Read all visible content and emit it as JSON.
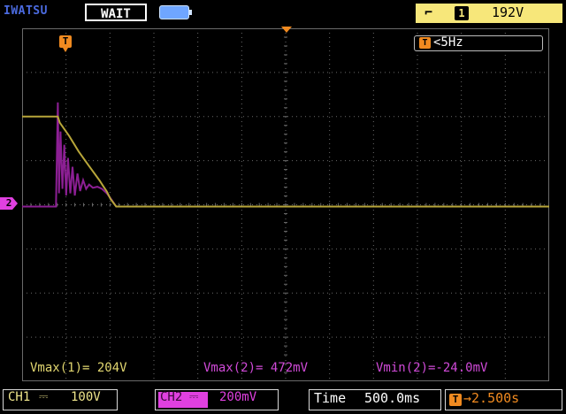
{
  "header": {
    "brand": "IWATSU",
    "run_status": "WAIT",
    "trigger": {
      "edge_icon": "rising-edge-icon",
      "source": "1",
      "level": "192V"
    }
  },
  "markers": {
    "trigger_time": "T",
    "ch2_ground": "2"
  },
  "frequency": {
    "icon": "T",
    "readout": "<5Hz"
  },
  "measurements": [
    {
      "text": "Vmax(1)= 204V",
      "color": "#e2d770"
    },
    {
      "text": "Vmax(2)= 472mV",
      "color": "#d04ad8"
    },
    {
      "text": "Vmin(2)=-24.0mV",
      "color": "#d04ad8"
    }
  ],
  "footer": {
    "ch1": {
      "label": "CH1",
      "coupling": "⎓",
      "scale": "100V"
    },
    "ch2": {
      "label": "CH2",
      "coupling": "⎓",
      "scale": "200mV"
    },
    "timebase": {
      "label": "Time",
      "value": "500.0ms"
    },
    "delay": {
      "icon": "T",
      "value": "→2.500s"
    }
  },
  "colors": {
    "ch1": "#b8a63a",
    "ch2": "#8c1f94",
    "trigger": "#f08a20",
    "grid": "#6a6a6a"
  },
  "chart_data": {
    "type": "line",
    "series": [
      {
        "channel": "CH1",
        "volts_per_div": 100,
        "x": [
          -2.0,
          -1.05,
          -1.0,
          -0.75,
          -0.5,
          -0.25,
          0.05,
          0.15,
          0.25,
          0.35,
          0.5,
          0.7,
          1.0,
          1.5,
          2.0,
          3.0,
          4.0,
          5.0,
          6.0,
          7.0,
          8.0,
          9.0,
          10.0,
          11.0,
          12.0
        ],
        "y": [
          204,
          204,
          190,
          160,
          125,
          95,
          60,
          47,
          34,
          17,
          0,
          0,
          0,
          0,
          0,
          0,
          0,
          0,
          0,
          0,
          0,
          0,
          0,
          0,
          0
        ]
      },
      {
        "channel": "CH2",
        "volts_per_div": 0.2,
        "x": [
          -2.0,
          -1.2,
          -1.1,
          -1.05,
          -1.02,
          -0.98,
          -0.93,
          -0.88,
          -0.83,
          -0.78,
          -0.72,
          -0.66,
          -0.6,
          -0.53,
          -0.46,
          -0.38,
          -0.3,
          -0.22,
          -0.12,
          0.0,
          0.12,
          0.25,
          0.38,
          0.5,
          1.5,
          3.0,
          4.5,
          5.5,
          6.5,
          7.5,
          8.5,
          10.0,
          11.0,
          12.0
        ],
        "y": [
          0,
          0,
          0,
          0.472,
          0.06,
          0.34,
          0.08,
          0.28,
          0.05,
          0.22,
          0.06,
          0.18,
          0.05,
          0.15,
          0.07,
          0.12,
          0.08,
          0.1,
          0.085,
          0.09,
          0.08,
          0.06,
          0.03,
          0,
          0,
          0,
          0,
          0,
          0,
          0,
          0,
          0,
          0,
          0
        ]
      }
    ],
    "x_divisions": 12,
    "y_divisions": 8,
    "xlim": [
      -2.0,
      12.0
    ],
    "ylim": [
      -4,
      4
    ],
    "grid": true
  }
}
